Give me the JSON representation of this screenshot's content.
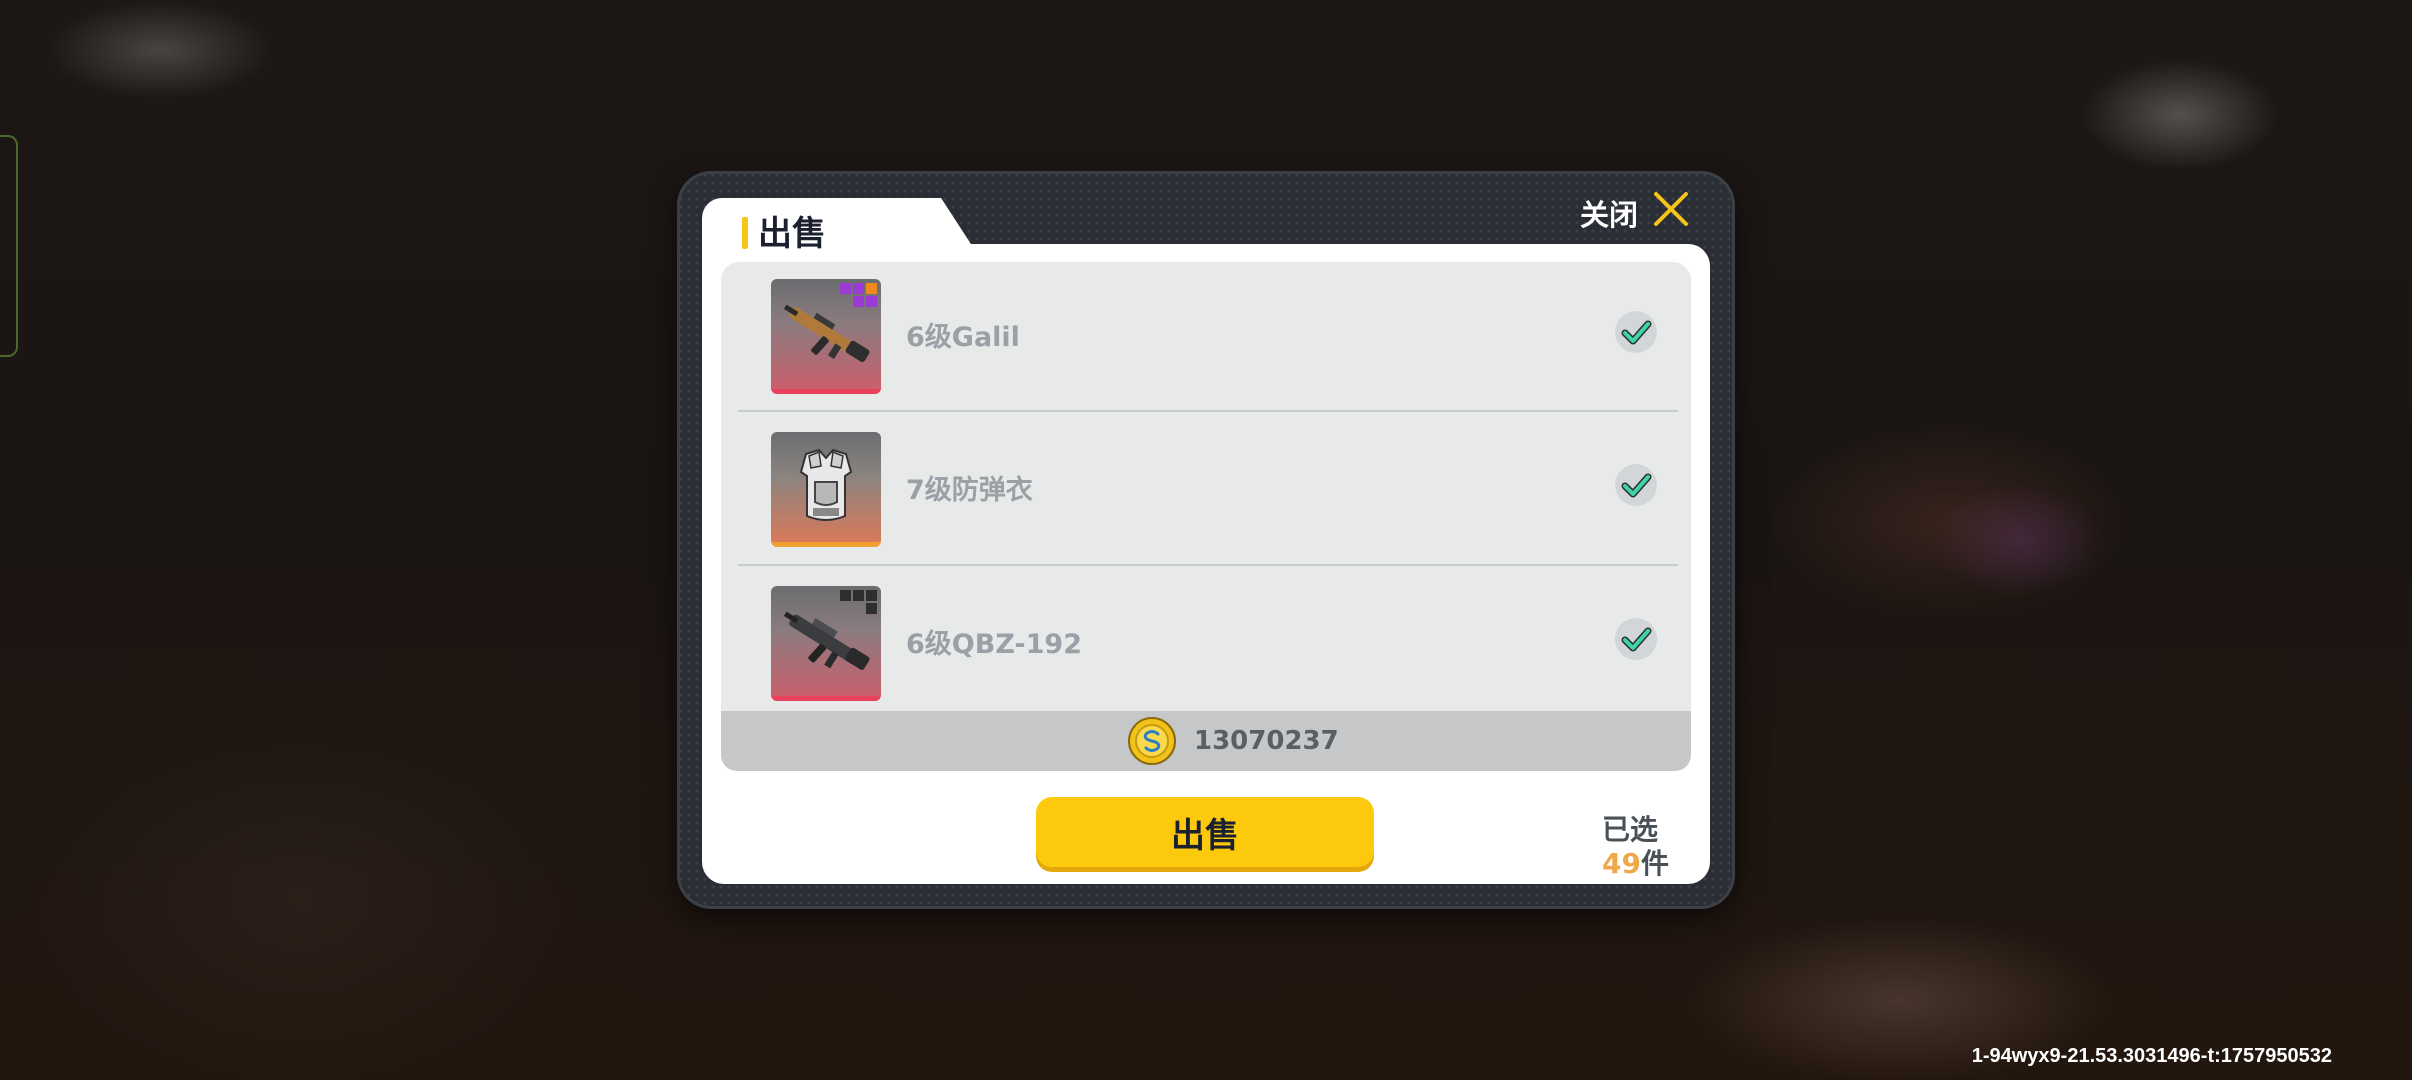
{
  "dialog": {
    "title": "出售",
    "close_label": "关闭"
  },
  "items": [
    {
      "name": "6级Galil",
      "icon": "rifle-galil-icon",
      "rarity_color": "#e8415e",
      "checked": true
    },
    {
      "name": "7级防弹衣",
      "icon": "body-armor-icon",
      "rarity_color": "#f0a030",
      "checked": true
    },
    {
      "name": "6级QBZ-192",
      "icon": "rifle-qbz-icon",
      "rarity_color": "#e8415e",
      "checked": true
    }
  ],
  "total": {
    "icon": "coin-icon",
    "value": "13070237"
  },
  "actions": {
    "sell_label": "出售"
  },
  "selection": {
    "label": "已选",
    "count": "49",
    "unit": "件"
  },
  "watermark": "1-94wyx9-21.53.3031496-t:1757950532",
  "colors": {
    "accent": "#fcc90d",
    "check": "#3ed6a0",
    "count": "#f0a94a"
  }
}
